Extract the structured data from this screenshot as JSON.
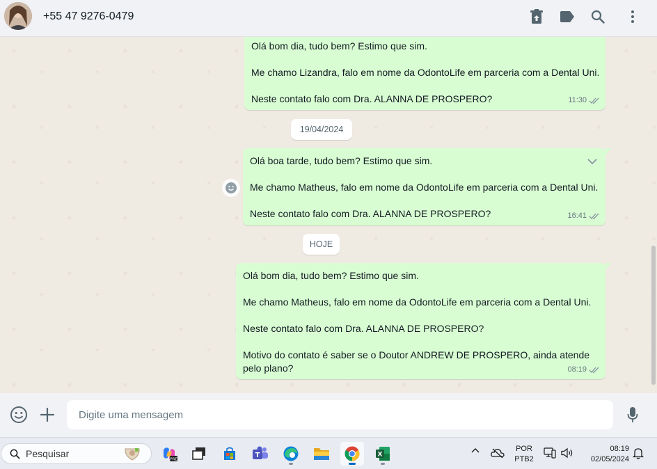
{
  "header": {
    "contact_name": "+55 47 9276-0479",
    "icons": [
      "delete-icon",
      "label-icon",
      "search-icon",
      "menu-icon"
    ]
  },
  "messages": [
    {
      "lines": [
        "Olá bom dia, tudo bem? Estimo que sim.",
        "",
        "Me chamo Lizandra, falo em nome da OdontoLife em parceria com a Dental Uni.",
        "",
        "Neste contato falo com Dra. ALANNA DE PROSPERO?"
      ],
      "time": "11:30"
    },
    {
      "lines": [
        "Olá boa tarde, tudo bem? Estimo que sim.",
        "",
        "Me chamo Matheus, falo em nome da OdontoLife em parceria com a Dental Uni.",
        "",
        "Neste contato falo com Dra. ALANNA DE PROSPERO?"
      ],
      "time": "16:41"
    },
    {
      "lines": [
        "Olá bom dia, tudo bem? Estimo que sim.",
        "",
        "Me chamo Matheus, falo em nome da OdontoLife em parceria com a Dental Uni.",
        "",
        "Neste contato falo com Dra. ALANNA DE PROSPERO?",
        "",
        "Motivo do contato é saber se o Doutor ANDREW DE PROSPERO, ainda atende",
        "pelo plano?"
      ],
      "time": "08:19"
    }
  ],
  "date_separators": [
    "19/04/2024",
    "HOJE"
  ],
  "composer": {
    "placeholder": "Digite uma mensagem"
  },
  "taskbar": {
    "search_label": "Pesquisar",
    "apps": [
      "copilot",
      "task-view",
      "microsoft-store",
      "teams",
      "edge",
      "file-explorer",
      "chrome",
      "excel"
    ],
    "language_top": "POR",
    "language_bottom": "PTB2",
    "time": "08:19",
    "date": "02/05/2024"
  },
  "colors": {
    "bubble_out": "#d9fdd3",
    "chat_bg": "#efeae2",
    "header_bg": "#f0f2f5",
    "tick_read": "#8696a0"
  }
}
